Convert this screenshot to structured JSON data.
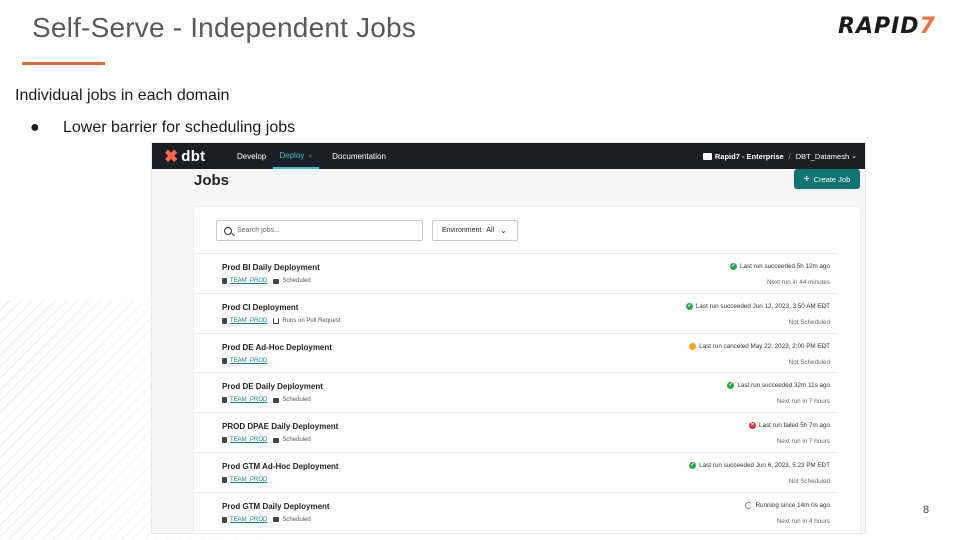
{
  "slide": {
    "title": "Self-Serve - Independent Jobs",
    "logo_main": "RAPID",
    "logo_accent": "7",
    "intro": "Individual jobs in each domain",
    "bullets": [
      {
        "marker": "●",
        "text": "Lower barrier for scheduling jobs"
      }
    ],
    "page_number": "8",
    "colors": {
      "underline": "#e06a35",
      "logo_accent": "#e8713c"
    }
  },
  "dbt": {
    "brand": "dbt",
    "nav": [
      {
        "label": "Develop",
        "active": false
      },
      {
        "label": "Deploy",
        "active": true
      },
      {
        "label": "Documentation",
        "active": false
      }
    ],
    "org": "Rapid7 - Enterprise",
    "separator": "/",
    "project": "DBT_Datamesh",
    "page_title": "Jobs",
    "create_button": "Create Job",
    "search_placeholder": "Search jobs...",
    "environment_label": "Environment",
    "environment_value": "All",
    "colors": {
      "nav_bg": "#1c1e26",
      "accent": "#3fbfcf",
      "button": "#127373",
      "success": "#2ea64f",
      "canceled": "#f2a31b",
      "failed": "#d9332b"
    },
    "jobs": [
      {
        "name": "Prod BI Daily Deployment",
        "environment": "TEAM_PROD",
        "trigger": "Scheduled",
        "trigger_icon": "calendar-icon",
        "status": "succeeded",
        "status_text": "Last run succeeded 5h 12m ago",
        "next_run": "Next run in 44 minutes"
      },
      {
        "name": "Prod CI Deployment",
        "environment": "TEAM_PROD",
        "trigger": "Runs on Pull Request",
        "trigger_icon": "pull-request-icon",
        "status": "succeeded",
        "status_text": "Last run succeeded Jun 12, 2023, 3:50 AM EDT",
        "next_run": "Not Scheduled"
      },
      {
        "name": "Prod DE Ad-Hoc Deployment",
        "environment": "TEAM_PROD",
        "trigger": "",
        "trigger_icon": "",
        "status": "canceled",
        "status_text": "Last run canceled May 22, 2023, 2:00 PM EDT",
        "next_run": "Not Scheduled"
      },
      {
        "name": "Prod DE Daily Deployment",
        "environment": "TEAM_PROD",
        "trigger": "Scheduled",
        "trigger_icon": "calendar-icon",
        "status": "succeeded",
        "status_text": "Last run succeeded 32m 11s ago",
        "next_run": "Next run in 7 hours"
      },
      {
        "name": "PROD DPAE Daily Deployment",
        "environment": "TEAM_PROD",
        "trigger": "Scheduled",
        "trigger_icon": "calendar-icon",
        "status": "failed",
        "status_text": "Last run failed 5h 7m ago",
        "next_run": "Next run in 7 hours"
      },
      {
        "name": "Prod GTM Ad-Hoc Deployment",
        "environment": "TEAM_PROD",
        "trigger": "",
        "trigger_icon": "",
        "status": "succeeded",
        "status_text": "Last run succeeded Jun 6, 2023, 5:23 PM EDT",
        "next_run": "Not Scheduled"
      },
      {
        "name": "Prod GTM Daily Deployment",
        "environment": "TEAM_PROD",
        "trigger": "Scheduled",
        "trigger_icon": "calendar-icon",
        "status": "running",
        "status_text": "Running since 14m 0s ago",
        "next_run": "Next run in 4 hours"
      }
    ]
  }
}
